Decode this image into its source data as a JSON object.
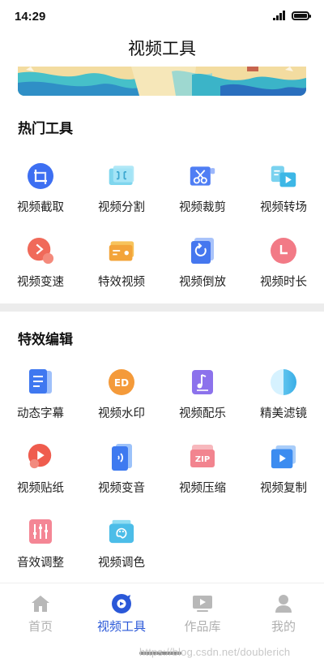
{
  "status_bar": {
    "time": "14:29",
    "signal_icon": "signal-icon",
    "battery_icon": "battery-icon"
  },
  "page_title": "视频工具",
  "banner": {
    "icon": "banner-illustration"
  },
  "sections": [
    {
      "title": "热门工具",
      "tools": [
        {
          "label": "视频截取",
          "icon": "crop-icon"
        },
        {
          "label": "视频分割",
          "icon": "split-icon"
        },
        {
          "label": "视频裁剪",
          "icon": "scissors-icon"
        },
        {
          "label": "视频转场",
          "icon": "transition-icon"
        },
        {
          "label": "视频变速",
          "icon": "speed-icon"
        },
        {
          "label": "特效视频",
          "icon": "effects-icon"
        },
        {
          "label": "视频倒放",
          "icon": "reverse-icon"
        },
        {
          "label": "视频时长",
          "icon": "clock-icon"
        }
      ]
    },
    {
      "title": "特效编辑",
      "tools": [
        {
          "label": "动态字幕",
          "icon": "subtitle-icon"
        },
        {
          "label": "视频水印",
          "icon": "watermark-icon",
          "glyph": "ED"
        },
        {
          "label": "视频配乐",
          "icon": "music-icon"
        },
        {
          "label": "精美滤镜",
          "icon": "filter-icon"
        },
        {
          "label": "视频贴纸",
          "icon": "sticker-icon"
        },
        {
          "label": "视频变音",
          "icon": "voice-change-icon"
        },
        {
          "label": "视频压缩",
          "icon": "compress-icon",
          "glyph": "ZIP"
        },
        {
          "label": "视频复制",
          "icon": "copy-icon"
        },
        {
          "label": "音效调整",
          "icon": "equalizer-icon"
        },
        {
          "label": "视频调色",
          "icon": "palette-icon"
        }
      ]
    }
  ],
  "tabbar": {
    "tabs": [
      {
        "label": "首页",
        "icon": "home-icon",
        "active": false
      },
      {
        "label": "视频工具",
        "icon": "video-tools-icon",
        "active": true
      },
      {
        "label": "作品库",
        "icon": "library-icon",
        "active": false
      },
      {
        "label": "我的",
        "icon": "profile-icon",
        "active": false
      }
    ],
    "active_color": "#2a58d8",
    "inactive_color": "#b0b0b0"
  },
  "watermark": "https://blog.csdn.net/doublerich"
}
